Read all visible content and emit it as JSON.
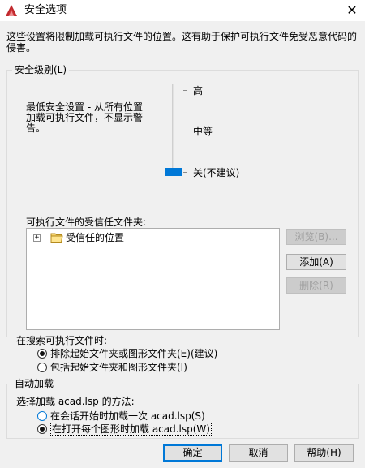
{
  "window": {
    "title": "安全选项",
    "close_symbol": "✕"
  },
  "description": "这些设置将限制加载可执行文件的位置。这有助于保护可执行文件免受恶意代码的侵害。",
  "security_level": {
    "label": "安全级别(L)",
    "description": "最低安全设置 - 从所有位置加载可执行文件，不显示警告。",
    "levels": [
      "高",
      "中等",
      "关(不建议)"
    ],
    "selected": "关(不建议)"
  },
  "trusted_folders": {
    "label": "可执行文件的受信任文件夹:",
    "tree_item": "受信任的位置",
    "expander": "+",
    "buttons": {
      "browse": "浏览(B)...",
      "add": "添加(A)",
      "delete": "删除(R)"
    }
  },
  "search": {
    "label": "在搜索可执行文件时:",
    "options": [
      "排除起始文件夹或图形文件夹(E)(建议)",
      "包括起始文件夹和图形文件夹(I)"
    ],
    "selected_index": 0
  },
  "autoload": {
    "group_label": "自动加载",
    "method_label": "选择加载 acad.lsp 的方法:",
    "options": [
      "在会话开始时加载一次 acad.lsp(S)",
      "在打开每个图形时加载 acad.lsp(W)"
    ],
    "selected_index": 1
  },
  "footer": {
    "ok": "确定",
    "cancel": "取消",
    "help": "帮助(H)"
  },
  "colors": {
    "accent": "#0078d7",
    "background": "#f0f0f0",
    "app_icon": "#c0282d"
  },
  "icons": {
    "app": "autocad-logo-icon",
    "close": "close-icon",
    "folder": "folder-icon"
  }
}
